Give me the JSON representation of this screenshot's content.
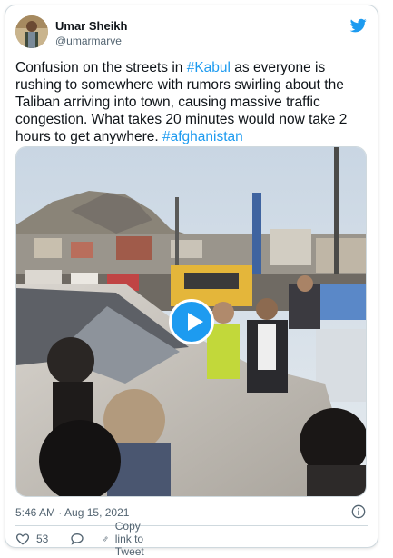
{
  "tweet": {
    "author_name": "Umar Sheikh",
    "author_handle": "@umarmarve",
    "text_part1": "Confusion on the streets in ",
    "hashtag1": "#Kabul",
    "text_part2": " as everyone is rushing to somewhere with rumors swirling about the Taliban arriving into town, causing massive traffic congestion. What takes 20 minutes would now take 2 hours to get anywhere. ",
    "hashtag2": "#afghanistan",
    "timestamp": "5:46 AM · Aug 15, 2021",
    "likes": "53",
    "copy_link_label": "Copy link to Tweet"
  },
  "icons": {
    "brand": "twitter-bird-icon",
    "info": "info-icon",
    "like": "heart-icon",
    "reply": "reply-bubble-icon",
    "copy_link": "link-icon",
    "play": "play-icon"
  },
  "colors": {
    "accent": "#1d9bf0",
    "text_primary": "#0f1419",
    "text_secondary": "#536471",
    "border": "#cfd9de"
  }
}
